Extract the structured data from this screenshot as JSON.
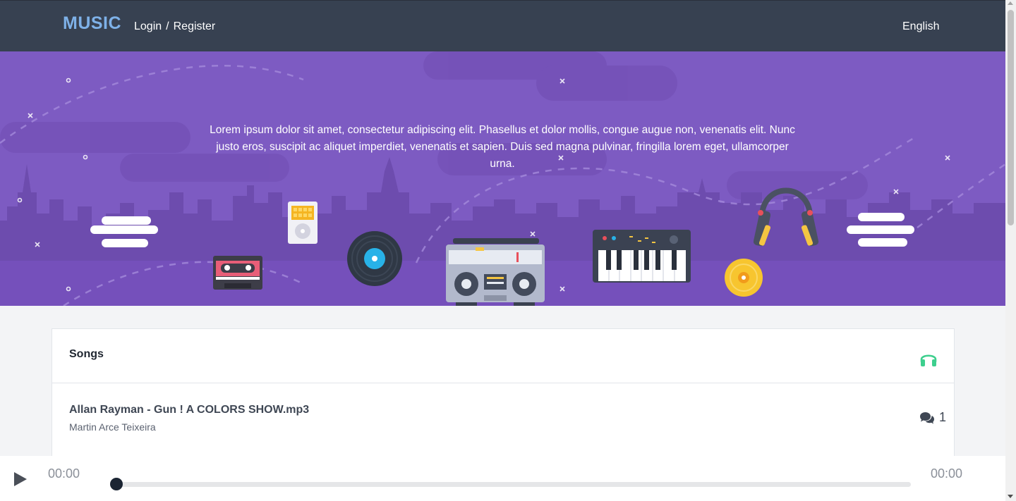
{
  "navbar": {
    "brand": "MUSIC",
    "login": "Login",
    "separator": "/",
    "register": "Register",
    "language": "English"
  },
  "hero": {
    "text": "Lorem ipsum dolor sit amet, consectetur adipiscing elit. Phasellus et dolor mollis, congue augue non, venenatis elit. Nunc justo eros, suscipit ac aliquet imperdiet, venenatis et sapien. Duis sed magna pulvinar, fringilla lorem eget, ullamcorper urna."
  },
  "songs": {
    "title": "Songs",
    "icon": "headphones-icon",
    "items": [
      {
        "title": "Allan Rayman - Gun ! A COLORS SHOW.mp3",
        "artist": "Martin Arce Teixeira",
        "comment_count": "1"
      }
    ]
  },
  "player": {
    "current_time": "00:00",
    "total_time": "00:00",
    "progress": 0
  },
  "colors": {
    "navbar": "#374151",
    "brand": "#7eb1e8",
    "hero": "#7d5bc2",
    "accent_green": "#3ecf8e"
  }
}
